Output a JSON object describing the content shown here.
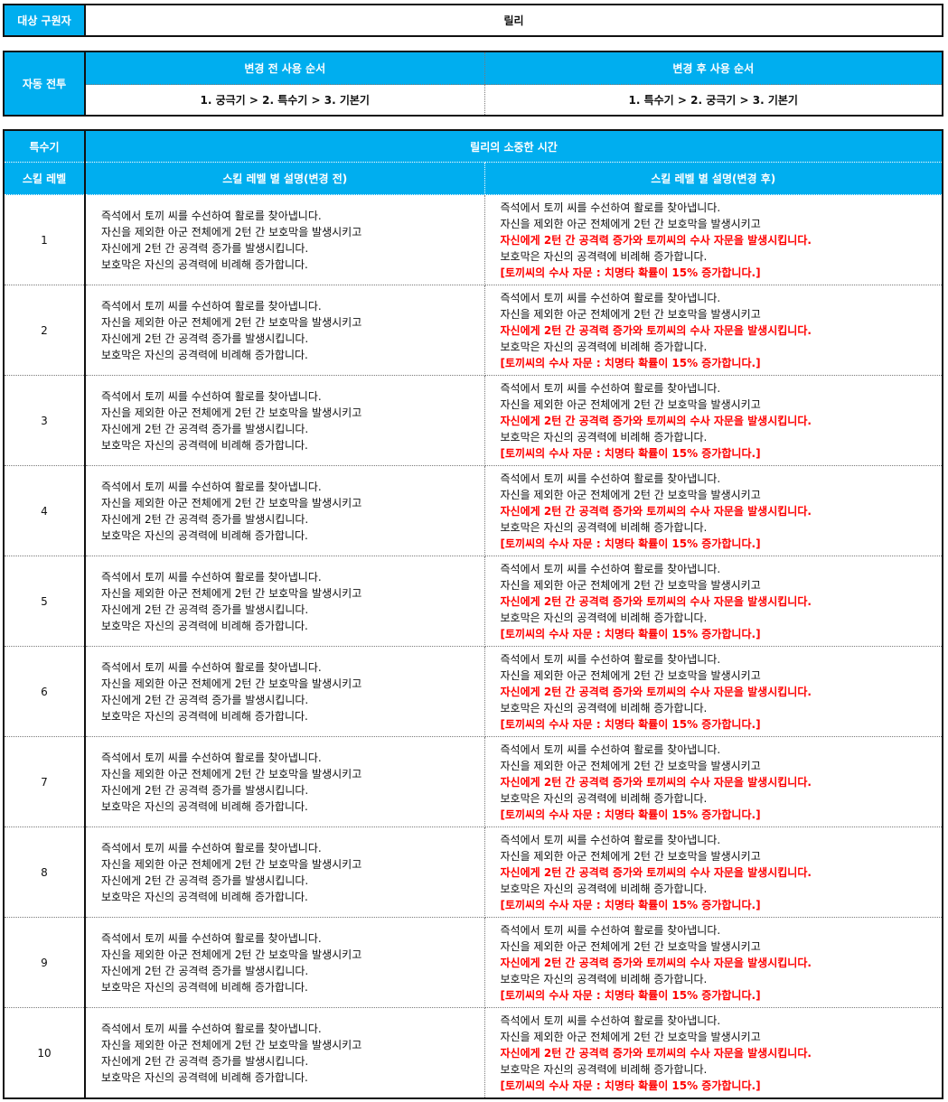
{
  "target": {
    "label": "대상 구원자",
    "value": "릴리"
  },
  "auto_battle": {
    "label": "자동 전투",
    "before_header": "변경 전 사용 순서",
    "after_header": "변경 후 사용 순서",
    "before_value": "1. 궁극기 > 2. 특수기 > 3. 기본기",
    "after_value": "1. 특수기 > 2. 궁극기 > 3. 기본기"
  },
  "skill": {
    "type_label": "특수기",
    "name": "릴리의 소중한 시간",
    "level_header": "스킬 레벨",
    "before_header": "스킬 레벨 별 설명(변경 전)",
    "after_header": "스킬 레벨 별 설명(변경 후)",
    "before_lines": [
      "즉석에서 토끼 씨를 수선하여 활로를 찾아냅니다.",
      "자신을 제외한 아군 전체에게 2턴 간 보호막을 발생시키고",
      "자신에게 2턴 간 공격력 증가를 발생시킵니다.",
      "보호막은 자신의 공격력에 비례해 증가합니다."
    ],
    "after_lines": [
      {
        "text": "즉석에서 토끼 씨를 수선하여 활로를 찾아냅니다.",
        "highlight": false
      },
      {
        "text": "자신을 제외한 아군 전체에게 2턴 간 보호막을 발생시키고",
        "highlight": false
      },
      {
        "text": "자신에게 2턴 간 공격력 증가와 토끼씨의 수사 자문을 발생시킵니다.",
        "highlight": true
      },
      {
        "text": "보호막은 자신의 공격력에 비례해 증가합니다.",
        "highlight": false
      },
      {
        "text": "[토끼씨의 수사 자문 : 치명타 확률이 15% 증가합니다.]",
        "highlight": true
      }
    ],
    "highlight_color": "#ff0000",
    "levels": [
      "1",
      "2",
      "3",
      "4",
      "5",
      "6",
      "7",
      "8",
      "9",
      "10"
    ]
  }
}
